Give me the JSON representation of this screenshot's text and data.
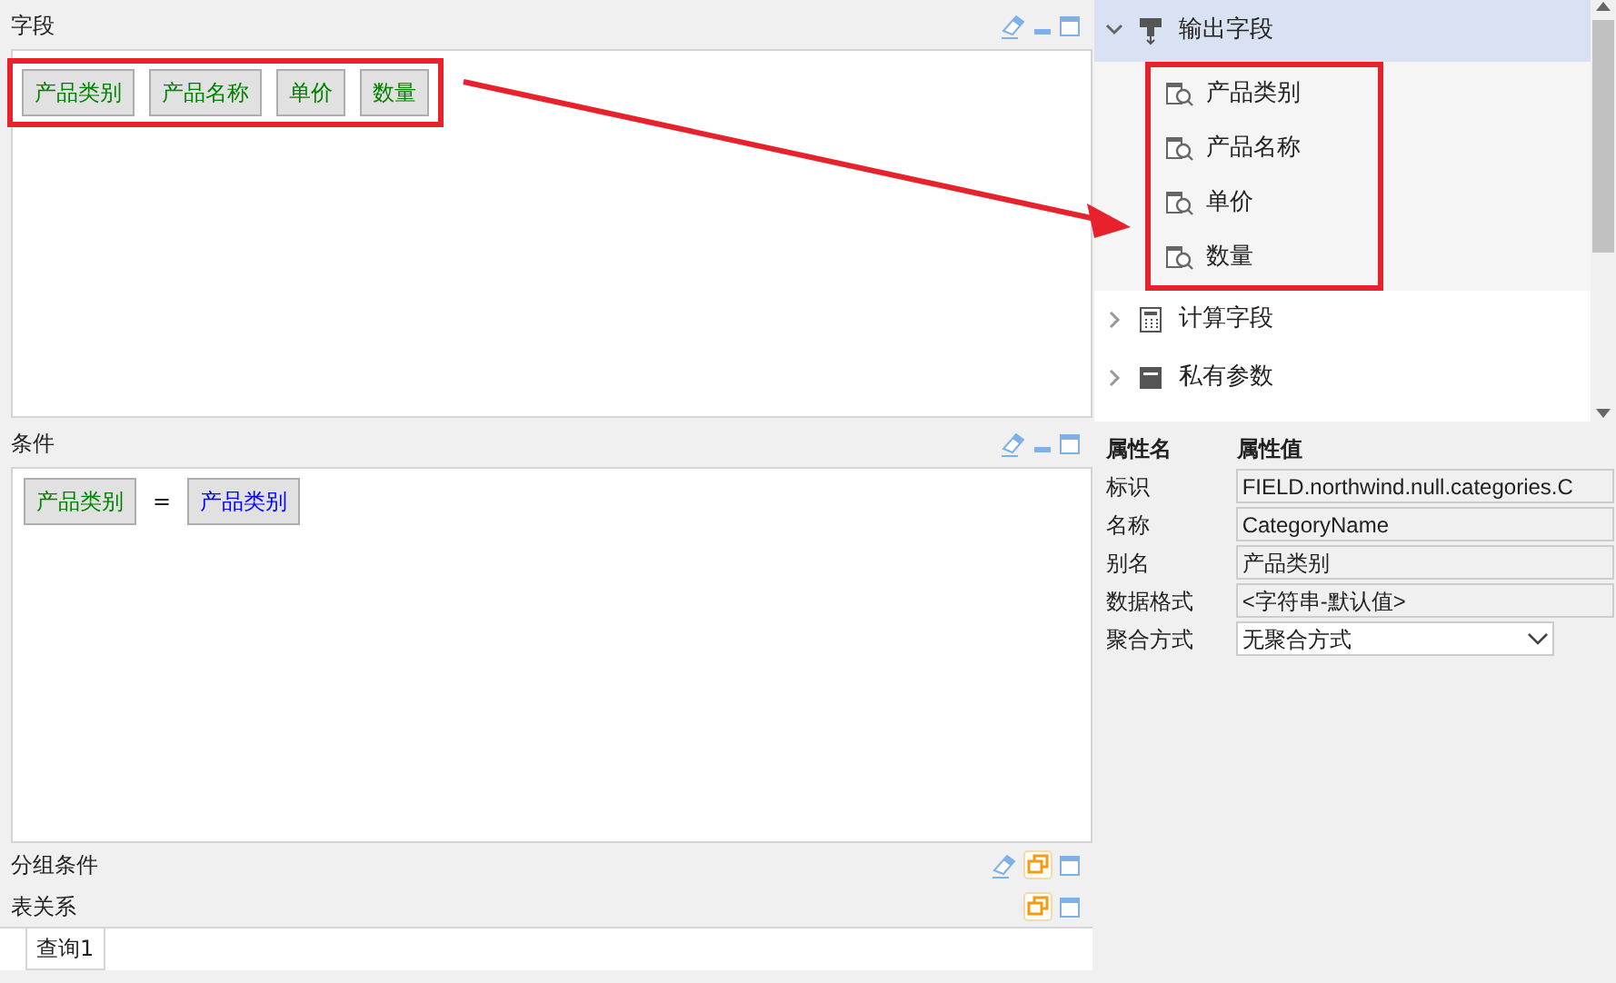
{
  "sections": [
    {
      "title": "字段",
      "tools": [
        {
          "kind": "eraser"
        },
        {
          "kind": "minimize"
        },
        {
          "kind": "maximize"
        }
      ],
      "kind": "fields",
      "chips": [
        {
          "text": "产品类别"
        },
        {
          "text": "产品名称"
        },
        {
          "text": "单价"
        },
        {
          "text": "数量"
        }
      ]
    },
    {
      "title": "条件",
      "tools": [
        {
          "kind": "eraser"
        },
        {
          "kind": "minimize"
        },
        {
          "kind": "maximize"
        }
      ],
      "kind": "conditions",
      "conditions": [
        {
          "left": {
            "text": "产品类别",
            "color": "#008000"
          },
          "operator": "=",
          "right": {
            "text": "产品类别",
            "color": "#0000ff"
          }
        }
      ]
    },
    {
      "title": "分组条件",
      "tools": [
        {
          "kind": "eraser"
        },
        {
          "kind": "restore"
        },
        {
          "kind": "maximize"
        }
      ],
      "kind": "collapsed"
    },
    {
      "title": "表关系",
      "tools": [
        {
          "kind": "restore"
        },
        {
          "kind": "maximize"
        }
      ],
      "kind": "tabs",
      "tabs": [
        {
          "label": "查询1",
          "selected": true
        }
      ]
    }
  ],
  "tree": [
    {
      "label": "输出字段",
      "kind": "output",
      "expanded": true,
      "selected": true,
      "children": [
        {
          "label": "产品类别",
          "selected": false
        },
        {
          "label": "产品名称",
          "selected": false
        },
        {
          "label": "单价",
          "selected": false
        },
        {
          "label": "数量",
          "selected": false
        }
      ]
    },
    {
      "label": "计算字段",
      "kind": "calculator",
      "expanded": false,
      "selected": false
    },
    {
      "label": "私有参数",
      "kind": "parameter",
      "expanded": false,
      "selected": false
    }
  ],
  "properties": {
    "headers": [
      "属性名",
      "属性值"
    ],
    "rows": [
      {
        "name": "标识",
        "value": "FIELD.northwind.null.categories.C",
        "kind": "text"
      },
      {
        "name": "名称",
        "value": "CategoryName",
        "kind": "text"
      },
      {
        "name": "别名",
        "value": "产品类别",
        "kind": "text"
      },
      {
        "name": "数据格式",
        "value": "<字符串-默认值>",
        "kind": "text"
      },
      {
        "name": "聚合方式",
        "value": "无聚合方式",
        "kind": "select"
      }
    ]
  }
}
